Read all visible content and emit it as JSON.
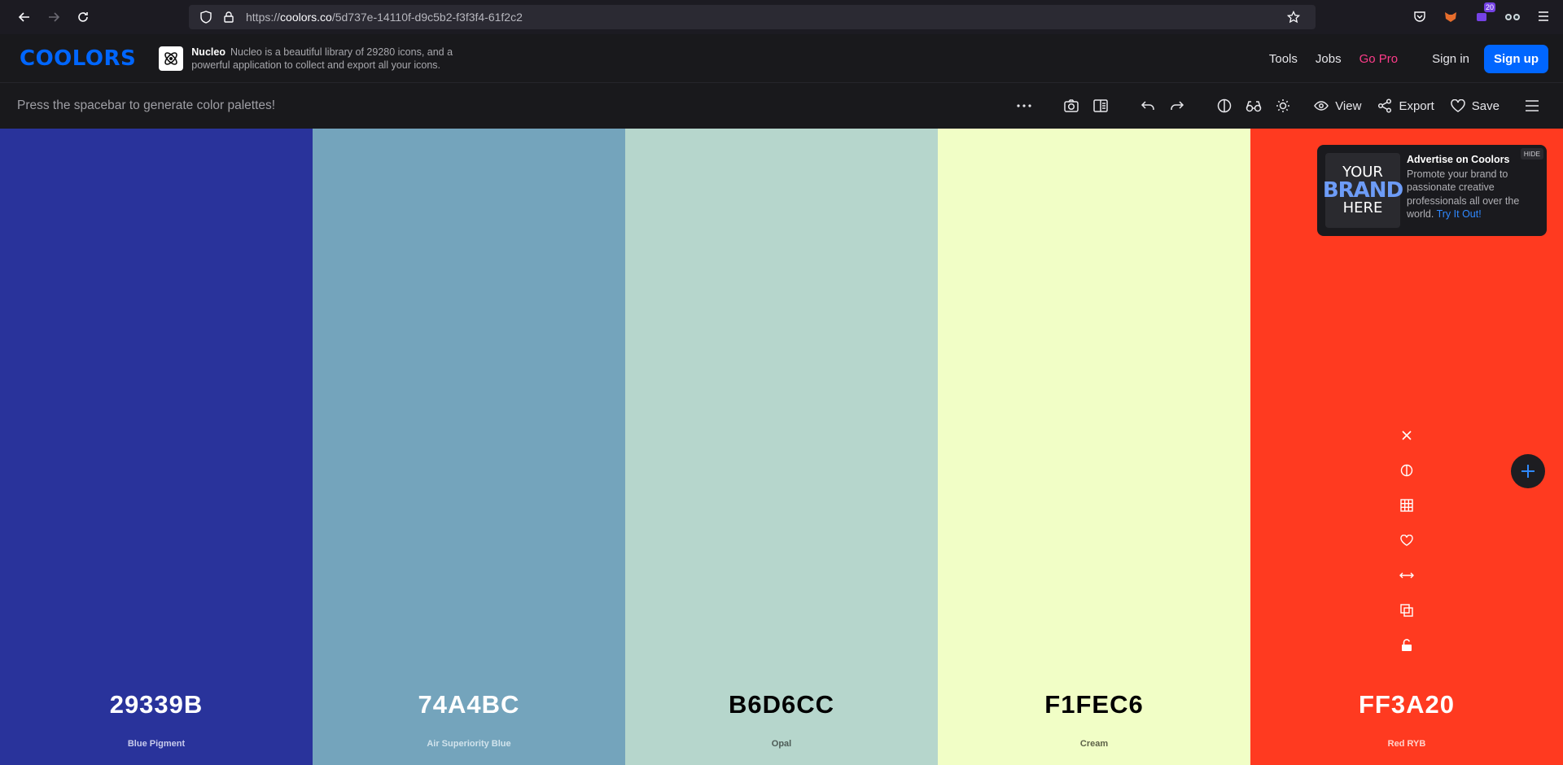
{
  "browser": {
    "url_prefix": "https://",
    "url_host": "coolors.co",
    "url_path": "/5d737e-14110f-d9c5b2-f3f3f4-61f2c2",
    "ext_badge": "20"
  },
  "header": {
    "logo": "COOLORS",
    "promo_title": "Nucleo",
    "promo_text": "Nucleo is a beautiful library of 29280 icons, and a powerful application to collect and export all your icons.",
    "nav": [
      "Tools",
      "Jobs",
      "Go Pro"
    ],
    "signin": "Sign in",
    "signup": "Sign up"
  },
  "toolbar": {
    "hint": "Press the spacebar to generate color palettes!",
    "view_label": "View",
    "export_label": "Export",
    "save_label": "Save"
  },
  "palette": [
    {
      "hex": "29339B",
      "name": "Blue Pigment",
      "color": "#29339b",
      "text_color": "#ffffff",
      "name_color": "#c9ccec"
    },
    {
      "hex": "74A4BC",
      "name": "Air Superiority Blue",
      "color": "#74a4bc",
      "text_color": "#ffffff",
      "name_color": "#d1e3ec"
    },
    {
      "hex": "B6D6CC",
      "name": "Opal",
      "color": "#b6d6cc",
      "text_color": "#000000",
      "name_color": "#4e5c57"
    },
    {
      "hex": "F1FEC6",
      "name": "Cream",
      "color": "#f1fec6",
      "text_color": "#000000",
      "name_color": "#5d6148"
    },
    {
      "hex": "FF3A20",
      "name": "Red RYB",
      "color": "#ff3a20",
      "text_color": "#ffffff",
      "name_color": "#ffd3cc"
    }
  ],
  "ad": {
    "img_line1": "YOUR",
    "img_line2": "BRAND",
    "img_line3": "HERE",
    "title": "Advertise on Coolors",
    "body": "Promote your brand to passionate creative professionals all over the world.",
    "cta": "Try It Out!",
    "hide": "HIDE"
  }
}
